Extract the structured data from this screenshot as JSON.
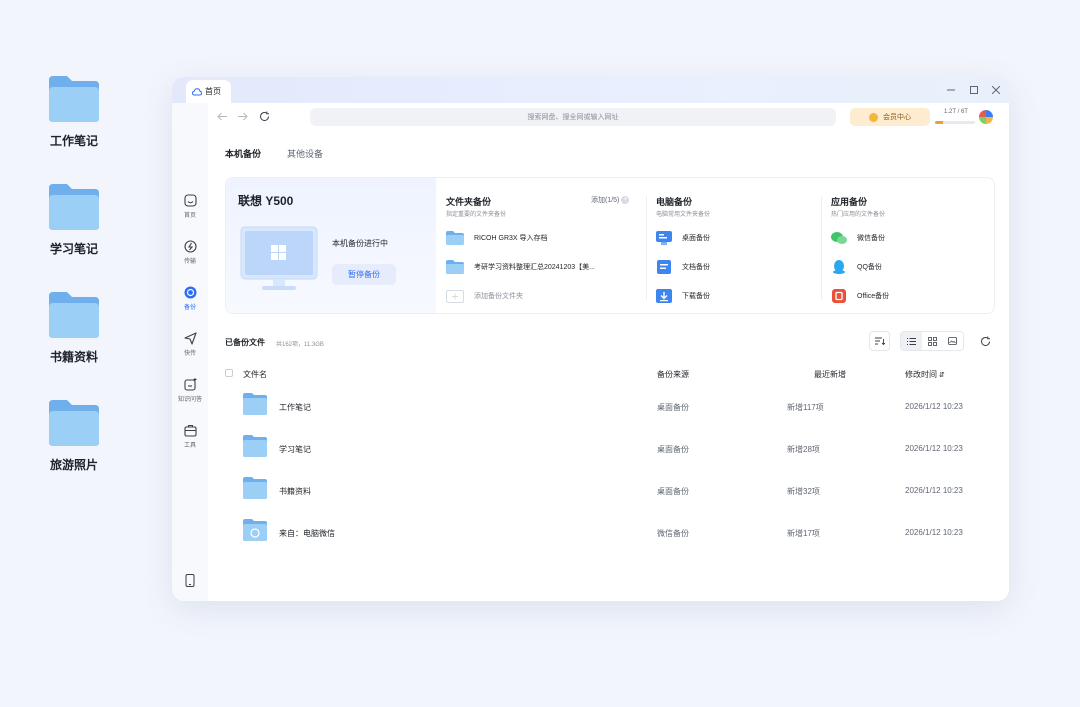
{
  "desktop": {
    "icons": [
      {
        "label": "工作笔记"
      },
      {
        "label": "学习笔记"
      },
      {
        "label": "书籍资料"
      },
      {
        "label": "旅游照片"
      }
    ]
  },
  "window": {
    "tab_title": "首页",
    "address_placeholder": "搜索网盘、搜全网或输入网址",
    "vip_label": "会员中心",
    "storage_text": "1.2T / 6T",
    "storage_fraction": 0.2
  },
  "sidebar": {
    "items": [
      {
        "label": "首页",
        "icon": "home-icon"
      },
      {
        "label": "传输",
        "icon": "transfer-icon"
      },
      {
        "label": "备份",
        "icon": "backup-icon"
      },
      {
        "label": "快传",
        "icon": "send-icon"
      },
      {
        "label": "知识问答",
        "icon": "knowledge-icon"
      },
      {
        "label": "工具",
        "icon": "toolbox-icon"
      }
    ]
  },
  "subtabs": [
    "本机备份",
    "其他设备"
  ],
  "device": {
    "name": "联想 Y500",
    "status": "本机备份进行中",
    "pause_label": "暂停备份"
  },
  "folder_backup": {
    "title": "文件夹备份",
    "subtitle": "指定重要的文件夹备份",
    "add_label": "添加(1/5)",
    "items": [
      "RICOH GR3X 导入存档",
      "考研学习资料整理汇总20241203【美..."
    ],
    "add_folder_label": "添加备份文件夹"
  },
  "pc_backup": {
    "title": "电脑备份",
    "subtitle": "电脑常用文件夹备份",
    "items": [
      "桌面备份",
      "文档备份",
      "下载备份"
    ]
  },
  "app_backup": {
    "title": "应用备份",
    "subtitle": "热门应用的文件备份",
    "items": [
      "微信备份",
      "QQ备份",
      "Office备份"
    ]
  },
  "file_list": {
    "title": "已备份文件",
    "meta": "共162项，11.3GB",
    "columns": {
      "name": "文件名",
      "source": "备份来源",
      "recent": "最近新增",
      "modified": "修改时间"
    },
    "sort_indicator": "⇵",
    "rows": [
      {
        "name": "工作笔记",
        "source": "桌面备份",
        "recent": "新增117项",
        "modified": "2026/1/12 10:23"
      },
      {
        "name": "学习笔记",
        "source": "桌面备份",
        "recent": "新增28项",
        "modified": "2026/1/12 10:23"
      },
      {
        "name": "书籍资料",
        "source": "桌面备份",
        "recent": "新增32项",
        "modified": "2026/1/12 10:23"
      },
      {
        "name": "来自：电脑微信",
        "source": "微信备份",
        "recent": "新增17项",
        "modified": "2026/1/12 10:23"
      }
    ]
  },
  "colors": {
    "accent": "#2d6cf5",
    "folder": "#8ec6f3",
    "vip_bg": "#fdecd0",
    "wechat": "#3fc46a",
    "qq": "#2aa7f0",
    "office": "#e8513c"
  }
}
